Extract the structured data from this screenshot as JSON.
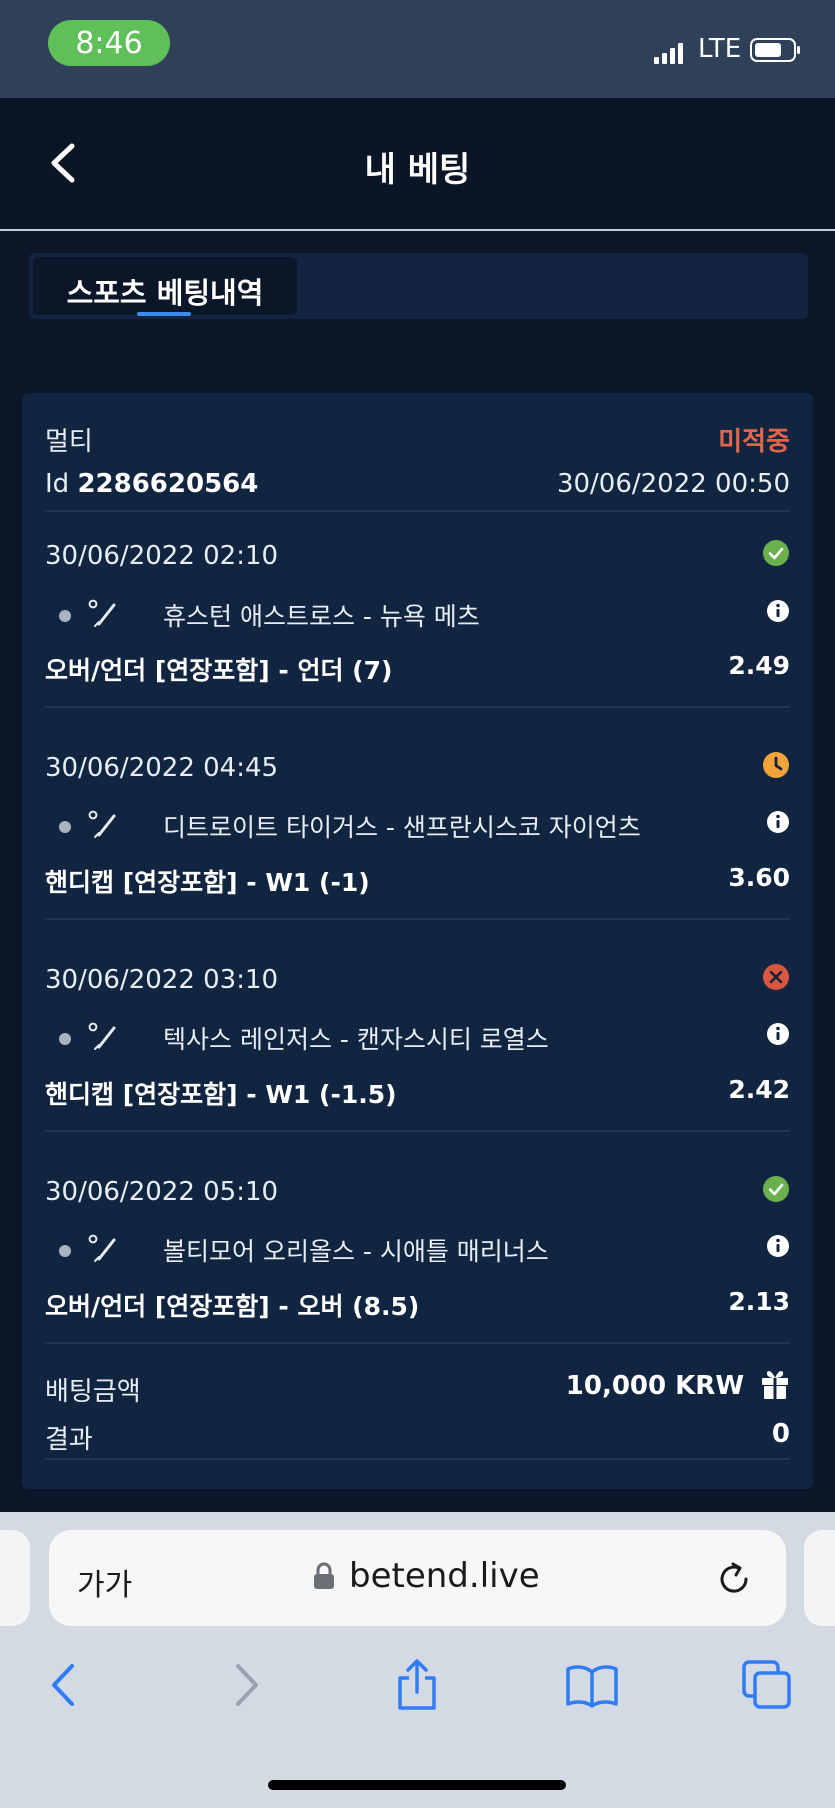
{
  "status_bar": {
    "time": "8:46",
    "network": "LTE",
    "time_pill_color": "#5fbf59"
  },
  "header": {
    "title": "내 베팅",
    "back_icon": "chevron-left-icon"
  },
  "tabs": [
    {
      "label": "스포츠 베팅내역",
      "active": true
    }
  ],
  "bet": {
    "type": "멀티",
    "status": "미적중",
    "status_color": "#e3654a",
    "id_label": "Id",
    "id_value": "2286620564",
    "placed_at": "30/06/2022 00:50",
    "selections": [
      {
        "datetime": "30/06/2022 02:10",
        "status": "won",
        "status_icon": "check-circle-icon",
        "event": "휴스턴 애스트로스 - 뉴욕 메츠",
        "market": "오버/언더 [연장포함] - 언더 (7)",
        "odds": "2.49"
      },
      {
        "datetime": "30/06/2022 04:45",
        "status": "pending",
        "status_icon": "clock-icon",
        "event": "디트로이트 타이거스 - 샌프란시스코 자이언츠",
        "market": "핸디캡 [연장포함] - W1 (-1)",
        "odds": "3.60"
      },
      {
        "datetime": "30/06/2022 03:10",
        "status": "lost",
        "status_icon": "cross-circle-icon",
        "event": "텍사스 레인저스 - 캔자스시티 로열스",
        "market": "핸디캡 [연장포함] - W1 (-1.5)",
        "odds": "2.42"
      },
      {
        "datetime": "30/06/2022 05:10",
        "status": "won",
        "status_icon": "check-circle-icon",
        "event": "볼티모어 오리올스 - 시애틀 매리너스",
        "market": "오버/언더 [연장포함] - 오버 (8.5)",
        "odds": "2.13"
      }
    ],
    "stake_label": "배팅금액",
    "stake_value": "10,000 KRW",
    "result_label": "결과",
    "result_value": "0"
  },
  "browser": {
    "text_size_label": "가가",
    "url": "betend.live",
    "toolbar_icons": [
      "back-arrow-icon",
      "forward-arrow-icon",
      "share-icon",
      "bookmarks-icon",
      "tabs-icon"
    ]
  },
  "colors": {
    "page_bg": "#0b1628",
    "card_bg": "#112540",
    "won": "#6ab04c",
    "pending": "#f2a33a",
    "lost": "#d9573f",
    "accent": "#3b8cf0"
  }
}
